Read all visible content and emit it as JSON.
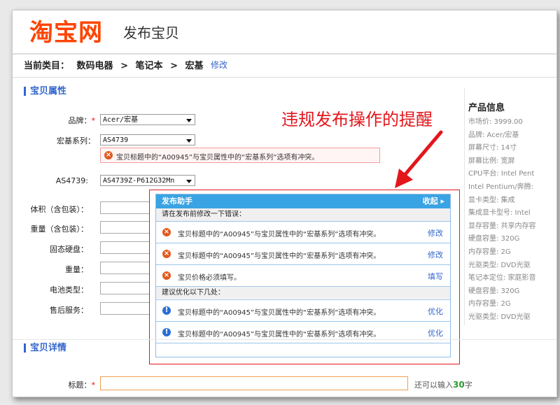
{
  "header": {
    "logo_text": "淘宝网",
    "subtitle": "发布宝贝"
  },
  "breadcrumb": {
    "prefix": "当前类目：",
    "items": [
      "数码电器",
      "笔记本",
      "宏基"
    ],
    "separator": ">",
    "edit": "修改"
  },
  "attributes": {
    "section_title": "宝贝属性",
    "brand": {
      "label": "品牌：",
      "required_mark": "*",
      "value": "Acer/宏基"
    },
    "series": {
      "label": "宏基系列：",
      "value": "AS4739"
    },
    "series_error": "宝贝标题中的“A00945”与宝贝属性中的“宏基系列”选项有冲突。",
    "model": {
      "label": "AS4739:",
      "value": "AS4739Z-P612G32Mn"
    },
    "fields": [
      {
        "label": "体积（含包装）："
      },
      {
        "label": "重量（含包装）："
      },
      {
        "label": "固态硬盘："
      },
      {
        "label": "重量："
      },
      {
        "label": "电池类型："
      },
      {
        "label": "售后服务："
      }
    ]
  },
  "annotation": "违规发布操作的提醒",
  "popup": {
    "title": "发布助手",
    "collapse": "收起",
    "errors_heading": "请在发布前修改一下错误：",
    "errors": [
      {
        "text": "宝贝标题中的“A00945”与宝贝属性中的“宏基系列”选项有冲突。",
        "action": "修改"
      },
      {
        "text": "宝贝标题中的“A00945”与宝贝属性中的“宏基系列”选项有冲突。",
        "action": "修改"
      },
      {
        "text": "宝贝价格必须填写。",
        "action": "填写"
      }
    ],
    "suggest_heading": "建议优化以下几处：",
    "suggestions": [
      {
        "text": "宝贝标题中的“A00945”与宝贝属性中的“宏基系列”选项有冲突。",
        "action": "优化"
      },
      {
        "text": "宝贝标题中的“A00945”与宝贝属性中的“宏基系列”选项有冲突。",
        "action": "优化"
      }
    ]
  },
  "product_info": {
    "title": "产品信息",
    "rows": [
      "市场价: 3999.00",
      "品牌: Acer/宏基",
      "屏幕尺寸: 14寸",
      "屏幕比例: 宽屏",
      "CPU平台: Intel Pent",
      "Intel Pentium/奔腾:",
      "显卡类型: 集成",
      "集成显卡型号: Intel",
      "显存容量: 共享内存容",
      "硬盘容量: 320G",
      "内存容量: 2G",
      "光驱类型: DVD光驱",
      "笔记本定位: 家庭影音",
      "硬盘容量: 320G",
      "内存容量: 2G",
      "光驱类型: DVD光驱"
    ]
  },
  "details": {
    "section_title": "宝贝详情",
    "title_label": "标题：",
    "required_mark": "*",
    "counter_prefix": "还可以输入",
    "counter_value": "30",
    "counter_suffix": "字"
  },
  "colors": {
    "accent": "#3366cc",
    "logo": "#ff4400",
    "alert": "#e3161c",
    "popup_header": "#3aa3e3"
  }
}
